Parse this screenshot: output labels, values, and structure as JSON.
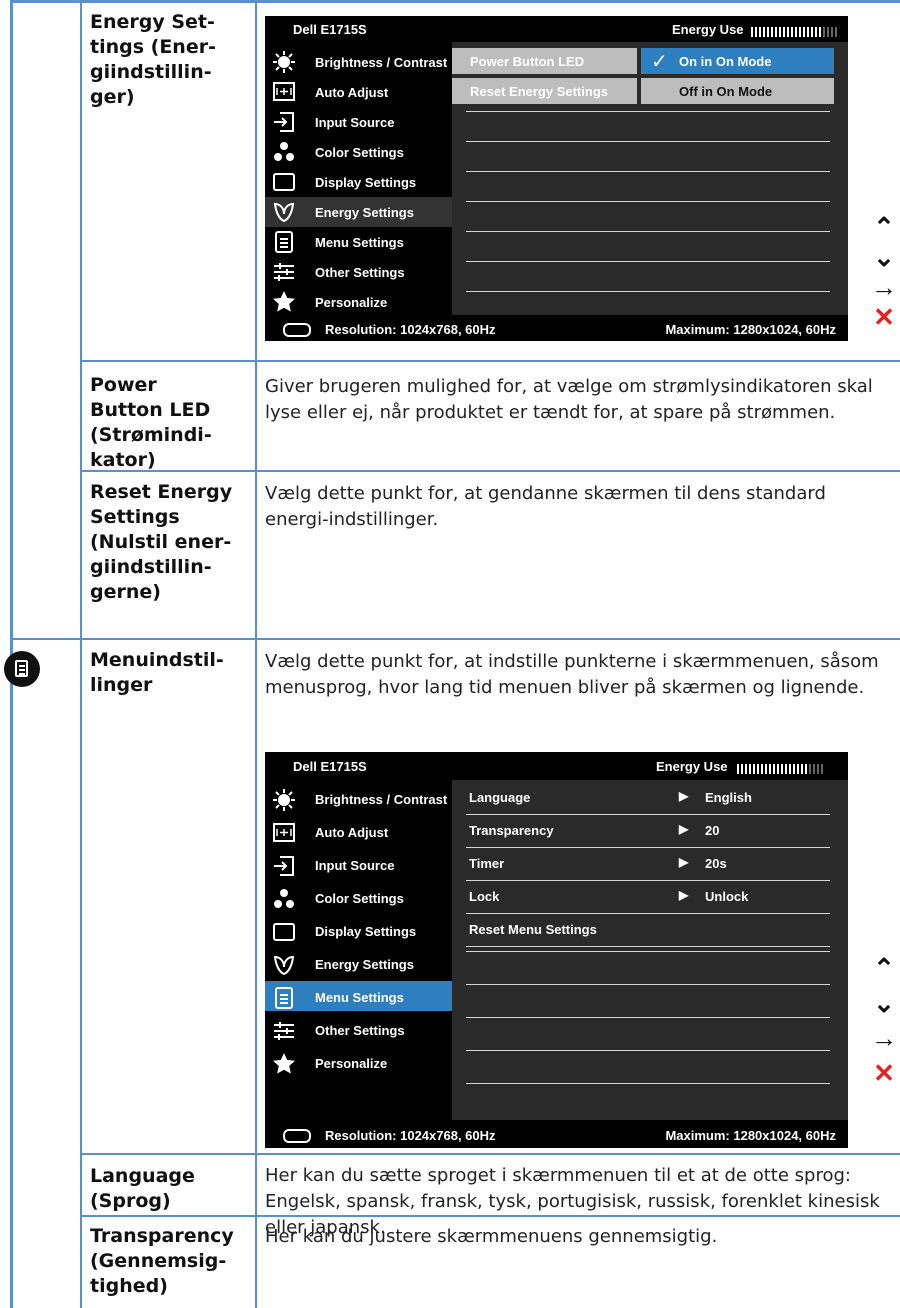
{
  "rows": {
    "energy_settings": {
      "label": "Energy Set-\ntings (Ener-\ngiindstillin-\nger)"
    },
    "power_button_led": {
      "label": "Power\nButton LED\n(Strømindi-\nkator)",
      "desc": "Giver brugeren mulighed for, at vælge om strømlysindikatoren skal lyse eller ej, når produktet er tændt for, at spare på strømmen."
    },
    "reset_energy": {
      "label": "Reset Energy\nSettings\n(Nulstil ener-\ngiindstillin-\ngerne)",
      "desc": "Vælg dette punkt for, at gendanne skærmen til dens standard energi-indstillinger."
    },
    "menu_settings": {
      "label": "Menuindstil-\nlinger",
      "desc": "Vælg dette punkt for, at indstille punkterne i skærmmenuen, såsom menusprog, hvor lang tid menuen bliver på skærmen og lignende."
    },
    "language": {
      "label": "Language\n(Sprog)",
      "desc": "Her kan du sætte sproget i skærmmenuen til et at de otte sprog: Engelsk, spansk, fransk, tysk, portugisisk, russisk, forenklet kinesisk eller japansk."
    },
    "transparency": {
      "label": "Transparency\n(Gennemsig-\ntighed)",
      "desc": "Her kan du justere skærmmenuens gennemsigtig."
    }
  },
  "osd": {
    "model": "Dell E1715S",
    "energy_use_label": "Energy Use",
    "energy_level": 0.8,
    "resolution": "Resolution: 1024x768, 60Hz",
    "maximum": "Maximum: 1280x1024, 60Hz",
    "menu": [
      {
        "label": "Brightness / Contrast",
        "icon": "brightness-icon"
      },
      {
        "label": "Auto Adjust",
        "icon": "auto-adjust-icon"
      },
      {
        "label": "Input Source",
        "icon": "input-source-icon"
      },
      {
        "label": "Color Settings",
        "icon": "color-settings-icon"
      },
      {
        "label": "Display Settings",
        "icon": "display-settings-icon"
      },
      {
        "label": "Energy Settings",
        "icon": "energy-leaf-icon"
      },
      {
        "label": "Menu Settings",
        "icon": "menu-settings-icon"
      },
      {
        "label": "Other Settings",
        "icon": "other-settings-icon"
      },
      {
        "label": "Personalize",
        "icon": "star-icon"
      }
    ],
    "energy_sub": {
      "item1": "Power Button LED",
      "item2": "Reset Energy Settings",
      "opt1": "On in On Mode",
      "opt2": "Off in On Mode",
      "check": "✓"
    },
    "menu_sub": [
      {
        "label": "Language",
        "value": "English"
      },
      {
        "label": "Transparency",
        "value": "20"
      },
      {
        "label": "Timer",
        "value": "20s"
      },
      {
        "label": "Lock",
        "value": "Unlock"
      },
      {
        "label": "Reset Menu Settings",
        "value": ""
      }
    ]
  },
  "nav": {
    "up": "⌃",
    "down": "⌄",
    "enter": "→",
    "exit": "✕"
  },
  "colors": {
    "accent_blue": "#2e7fc0",
    "table_line": "#5a8fcb",
    "exit_red": "#e82020"
  }
}
